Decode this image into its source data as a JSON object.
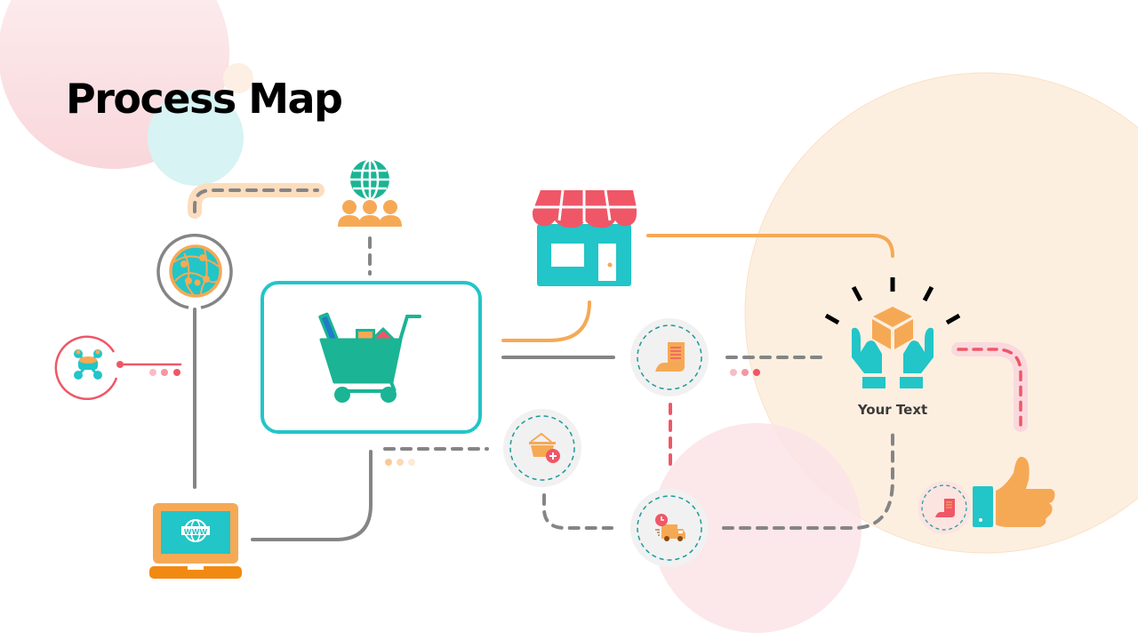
{
  "slide": {
    "title": "Process Map",
    "caption": "Your Text"
  },
  "colors": {
    "teal": "#22C5C8",
    "green": "#1BB494",
    "orange": "#F6A955",
    "dark_orange": "#F28A12",
    "red": "#EF5767",
    "gray": "#858585",
    "peach_bg": "#FDEFE0",
    "pink_bg": "#FCE8EA",
    "light_cyan_bg": "#D7F3F4"
  },
  "nodes": [
    {
      "id": "network-globe",
      "icon": "network-globe-icon"
    },
    {
      "id": "global-customers",
      "icon": "globe-people-icon"
    },
    {
      "id": "database-hub",
      "icon": "database-network-icon"
    },
    {
      "id": "shopping-cart",
      "icon": "shopping-cart-icon"
    },
    {
      "id": "storefront",
      "icon": "storefront-icon"
    },
    {
      "id": "receipt",
      "icon": "receipt-scroll-icon"
    },
    {
      "id": "add-to-basket",
      "icon": "basket-add-icon"
    },
    {
      "id": "delivery",
      "icon": "delivery-truck-icon"
    },
    {
      "id": "website-laptop",
      "icon": "laptop-www-icon"
    },
    {
      "id": "product-in-hands",
      "icon": "box-hands-icon"
    },
    {
      "id": "approval",
      "icon": "thumbs-up-icon"
    },
    {
      "id": "invoice",
      "icon": "invoice-scroll-icon"
    }
  ]
}
